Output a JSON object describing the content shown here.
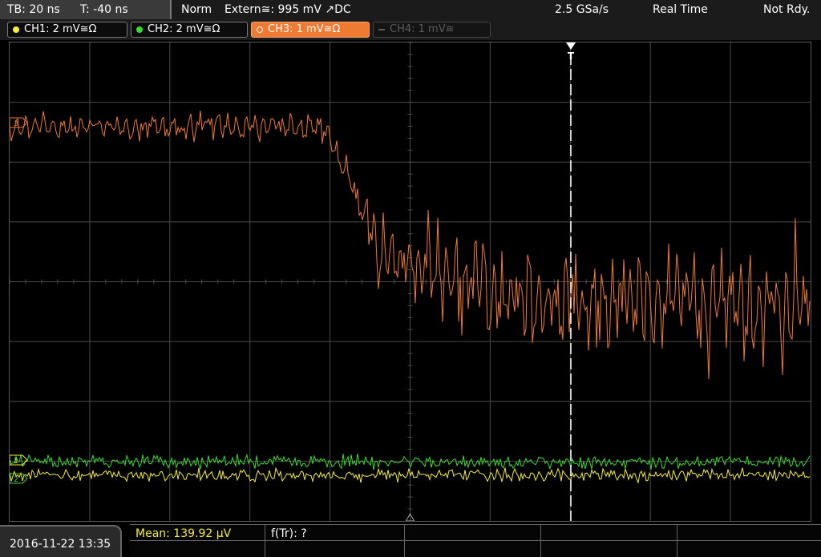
{
  "status_bar": {
    "timebase": "TB: 20 ns",
    "trigger_offset": "T: -40 ns",
    "trigger_mode": "Norm",
    "trigger_source": "Extern≅: 995 mV ↗DC",
    "sample_rate": "2.5 GSa/s",
    "acquisition_mode": "Real Time",
    "status": "Not Rdy."
  },
  "channels": [
    {
      "label": "CH1: 2 mV≅Ω",
      "color": "#f6ee3c",
      "active": false,
      "enabled": true
    },
    {
      "label": "CH2: 2 mV≅Ω",
      "color": "#3adb2e",
      "active": false,
      "enabled": true
    },
    {
      "label": "CH3: 1 mV≅Ω",
      "color": "#f07a32",
      "active": true,
      "enabled": true
    },
    {
      "label": "CH4: 1 mV≅",
      "color": "#5c5c5c",
      "active": false,
      "enabled": false
    }
  ],
  "trigger_marker": "T",
  "channel_markers": [
    "1",
    "2",
    "3"
  ],
  "bottom": {
    "datetime": "2016-11-22 13:35",
    "measurement_1": "Mean: 139.92 µV",
    "measurement_2": "f(Tr): ?"
  },
  "colors": {
    "ch1": "#f6ee3c",
    "ch2": "#3adb2e",
    "ch3": "#f07a32",
    "grid": "#4a4a4a"
  }
}
